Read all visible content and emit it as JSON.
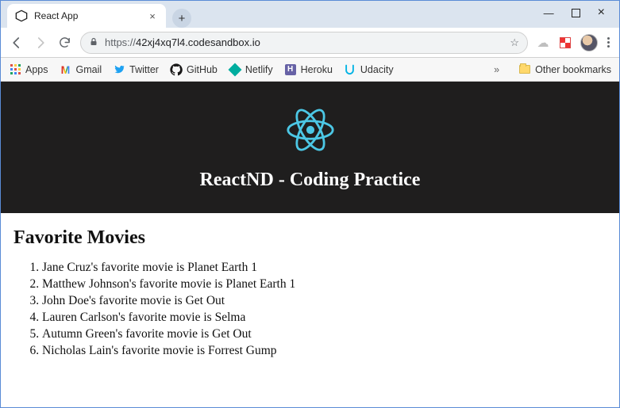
{
  "window": {
    "tab_title": "React App"
  },
  "address": {
    "protocol": "https://",
    "host": "42xj4xq7l4.codesandbox.io",
    "path": ""
  },
  "bookmarks": {
    "apps": "Apps",
    "items": [
      "Gmail",
      "Twitter",
      "GitHub",
      "Netlify",
      "Heroku",
      "Udacity"
    ],
    "other": "Other bookmarks"
  },
  "page": {
    "hero_title": "ReactND - Coding Practice",
    "section_title": "Favorite Movies",
    "movies": [
      "Jane Cruz's favorite movie is Planet Earth 1",
      "Matthew Johnson's favorite movie is Planet Earth 1",
      "John Doe's favorite movie is Get Out",
      "Lauren Carlson's favorite movie is Selma",
      "Autumn Green's favorite movie is Get Out",
      "Nicholas Lain's favorite movie is Forrest Gump"
    ]
  }
}
